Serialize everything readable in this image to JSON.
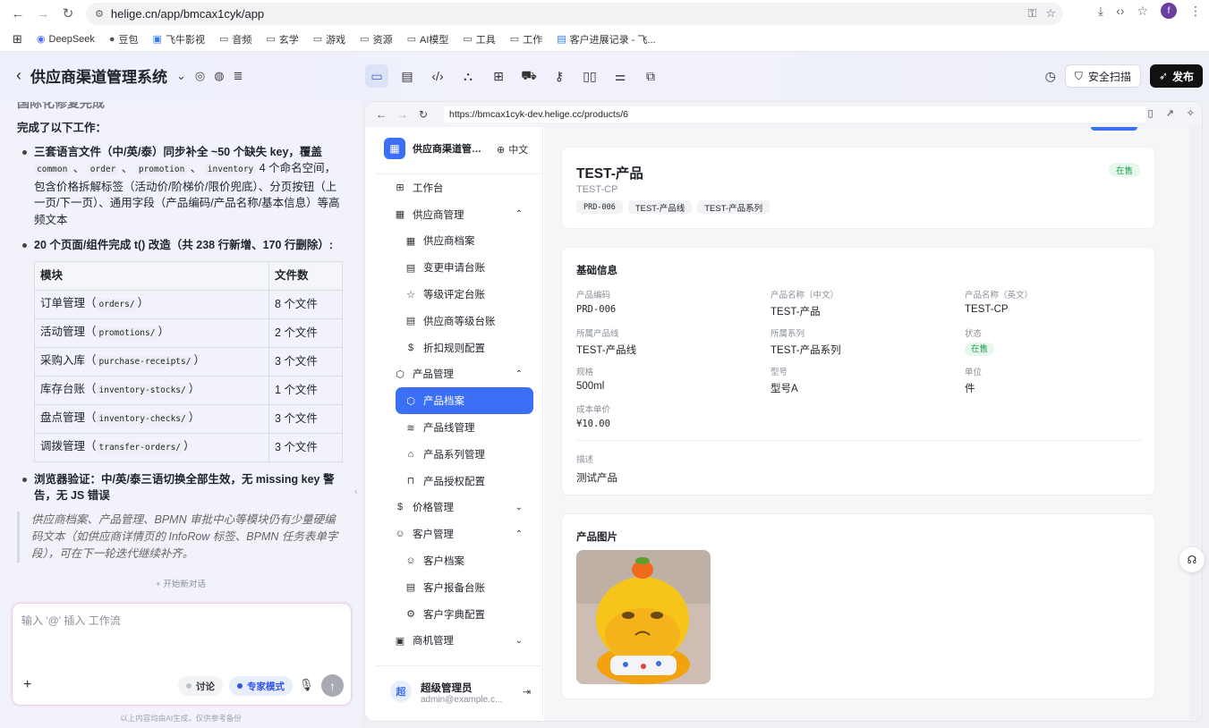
{
  "browser": {
    "url": "helige.cn/app/bmcax1cyk/app",
    "profile_initial": "f",
    "bookmarks": [
      "DeepSeek",
      "豆包",
      "飞牛影视",
      "音频",
      "玄学",
      "游戏",
      "资源",
      "AI模型",
      "工具",
      "工作",
      "客户进展记录 - 飞..."
    ]
  },
  "app": {
    "project_title": "供应商渠道管理系统",
    "scan_label": "安全扫描",
    "publish_label": "发布"
  },
  "chat": {
    "cut_title": "国际化修复完成",
    "intro": "完成了以下工作：",
    "bullet1_pre": "三套语言文件（中/英/泰）同步补全 ~50 个缺失 key，覆盖 ",
    "bullet1_ns1": "common",
    "bullet1_sep1": " 、 ",
    "bullet1_ns2": "order",
    "bullet1_sep2": " 、 ",
    "bullet1_ns3": "promotion",
    "bullet1_sep3": " 、 ",
    "bullet1_ns4": "inventory",
    "bullet1_post": " 4 个命名空间，包含价格拆解标签（活动价/阶梯价/限价兜底）、分页按钮（上一页/下一页）、通用字段（产品编码/产品名称/基本信息）等高频文本",
    "bullet2": "20 个页面/组件完成 t() 改造（共 238 行新增、170 行删除）:",
    "table_headers": [
      "模块",
      "文件数"
    ],
    "table_rows": [
      {
        "name": "订单管理（",
        "code": "orders/",
        "close": "）",
        "count": "8 个文件"
      },
      {
        "name": "活动管理（",
        "code": "promotions/",
        "close": "）",
        "count": "2 个文件"
      },
      {
        "name": "采购入库（",
        "code": "purchase-receipts/",
        "close": "）",
        "count": "3 个文件"
      },
      {
        "name": "库存台账（",
        "code": "inventory-stocks/",
        "close": "）",
        "count": "1 个文件"
      },
      {
        "name": "盘点管理（",
        "code": "inventory-checks/",
        "close": "）",
        "count": "3 个文件"
      },
      {
        "name": "调拨管理（",
        "code": "transfer-orders/",
        "close": "）",
        "count": "3 个文件"
      }
    ],
    "bullet3": "浏览器验证：中/英/泰三语切换全部生效，无 missing key 警告，无 JS 错误",
    "quote": "供应商档案、产品管理、BPMN 审批中心等模块仍有少量硬编码文本（如供应商详情页的 InfoRow 标签、BPMN 任务表单字段），可在下一轮迭代继续补齐。",
    "new_chat": "+ 开始新对话",
    "input_placeholder": "输入 '@' 插入 工作流",
    "mode_discuss": "讨论",
    "mode_expert": "专家模式",
    "disclaimer": "以上内容均由AI生成，仅供参考备份"
  },
  "preview": {
    "url": "https://bmcax1cyk-dev.helige.cc/products/6",
    "sidebar": {
      "brand": "供应商渠道管理...",
      "lang": "中文",
      "items": [
        {
          "label": "工作台",
          "icon": "dashboard-icon",
          "level": 0
        },
        {
          "label": "供应商管理",
          "icon": "building-icon",
          "level": 0,
          "chevron": "⌃"
        },
        {
          "label": "供应商档案",
          "icon": "building-icon",
          "level": 1
        },
        {
          "label": "变更申请台账",
          "icon": "file-icon",
          "level": 1
        },
        {
          "label": "等级评定台账",
          "icon": "star-icon",
          "level": 1
        },
        {
          "label": "供应商等级台账",
          "icon": "file-icon",
          "level": 1
        },
        {
          "label": "折扣规则配置",
          "icon": "dollar-icon",
          "level": 1
        },
        {
          "label": "产品管理",
          "icon": "box-icon",
          "level": 0,
          "chevron": "⌃"
        },
        {
          "label": "产品档案",
          "icon": "box-icon",
          "level": 1,
          "active": true
        },
        {
          "label": "产品线管理",
          "icon": "layers-icon",
          "level": 1
        },
        {
          "label": "产品系列管理",
          "icon": "tag-icon",
          "level": 1
        },
        {
          "label": "产品授权配置",
          "icon": "bag-icon",
          "level": 1
        },
        {
          "label": "价格管理",
          "icon": "dollar-circle-icon",
          "level": 0,
          "chevron": "⌄"
        },
        {
          "label": "客户管理",
          "icon": "user-icon",
          "level": 0,
          "chevron": "⌃"
        },
        {
          "label": "客户档案",
          "icon": "user-icon",
          "level": 1
        },
        {
          "label": "客户报备台账",
          "icon": "file-icon",
          "level": 1
        },
        {
          "label": "客户字典配置",
          "icon": "gear-icon",
          "level": 1
        },
        {
          "label": "商机管理",
          "icon": "briefcase-icon",
          "level": 0,
          "chevron": "⌄"
        }
      ],
      "user_initial": "超",
      "user_name": "超级管理员",
      "user_email": "admin@example.c..."
    },
    "product": {
      "name": "TEST-产品",
      "code": "TEST-CP",
      "tags": [
        "PRD-006",
        "TEST-产品线",
        "TEST-产品系列"
      ],
      "status": "在售"
    },
    "basic": {
      "title": "基础信息",
      "fields": [
        {
          "label": "产品编码",
          "value": "PRD-006",
          "mono": true
        },
        {
          "label": "产品名称（中文）",
          "value": "TEST-产品"
        },
        {
          "label": "产品名称（英文）",
          "value": "TEST-CP"
        },
        {
          "label": "所属产品线",
          "value": "TEST-产品线"
        },
        {
          "label": "所属系列",
          "value": "TEST-产品系列"
        },
        {
          "label": "状态",
          "value": "在售",
          "badge": true
        },
        {
          "label": "规格",
          "value": "500ml"
        },
        {
          "label": "型号",
          "value": "型号A"
        },
        {
          "label": "单位",
          "value": "件"
        },
        {
          "label": "成本单价",
          "value": "¥10.00",
          "mono": true
        }
      ],
      "desc_label": "描述",
      "desc_value": "测试产品"
    },
    "images": {
      "title": "产品图片"
    }
  }
}
